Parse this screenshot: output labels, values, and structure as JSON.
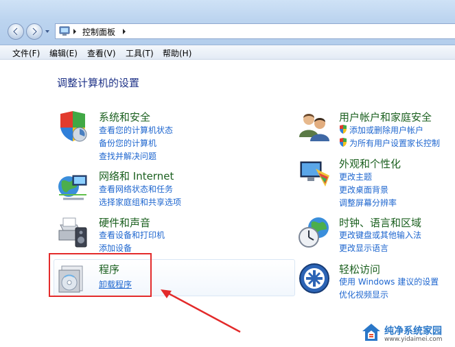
{
  "address": {
    "crumb": "控制面板"
  },
  "menu": [
    {
      "label": "文件(F)"
    },
    {
      "label": "编辑(E)"
    },
    {
      "label": "查看(V)"
    },
    {
      "label": "工具(T)"
    },
    {
      "label": "帮助(H)"
    }
  ],
  "heading": "调整计算机的设置",
  "left_categories": [
    {
      "title": "系统和安全",
      "icon": "system-security-icon",
      "links": [
        "查看您的计算机状态",
        "备份您的计算机",
        "查找并解决问题"
      ]
    },
    {
      "title": "网络和 Internet",
      "icon": "network-icon",
      "links": [
        "查看网络状态和任务",
        "选择家庭组和共享选项"
      ]
    },
    {
      "title": "硬件和声音",
      "icon": "hardware-sound-icon",
      "links": [
        "查看设备和打印机",
        "添加设备"
      ]
    },
    {
      "title": "程序",
      "icon": "programs-icon",
      "links": [
        "卸载程序"
      ]
    }
  ],
  "right_categories": [
    {
      "title": "用户帐户和家庭安全",
      "icon": "user-accounts-icon",
      "links": [
        "添加或删除用户帐户",
        "为所有用户设置家长控制"
      ]
    },
    {
      "title": "外观和个性化",
      "icon": "appearance-icon",
      "links": [
        "更改主题",
        "更改桌面背景",
        "调整屏幕分辨率"
      ]
    },
    {
      "title": "时钟、语言和区域",
      "icon": "clock-language-icon",
      "links": [
        "更改键盘或其他输入法",
        "更改显示语言"
      ]
    },
    {
      "title": "轻松访问",
      "icon": "ease-of-access-icon",
      "links": [
        "使用 Windows 建议的设置",
        "优化视频显示"
      ]
    }
  ],
  "watermark": {
    "logo_title": "纯净系统家园",
    "logo_url": "www.yidaimei.com"
  },
  "colors": {
    "title_green": "#1a5f1e",
    "link_blue": "#1e66cf",
    "heading_blue": "#1e3287",
    "annotation_red": "#e32a2a"
  }
}
